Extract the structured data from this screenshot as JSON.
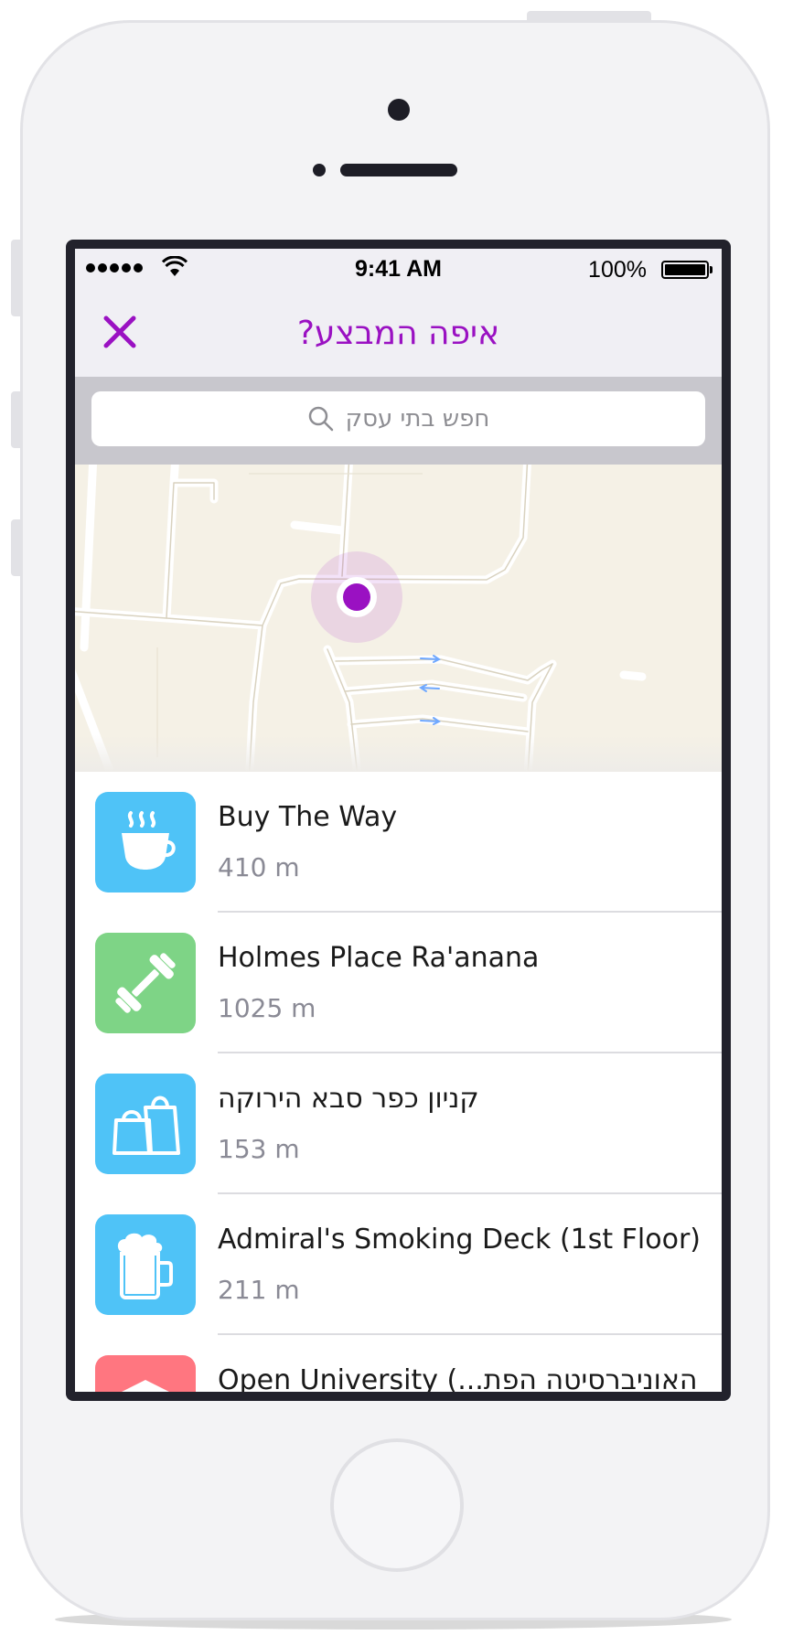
{
  "status_bar": {
    "time": "9:41 AM",
    "battery": "100%"
  },
  "nav": {
    "title": "איפה המבצע?",
    "close_icon": "close-icon",
    "accent_color": "#9a11c2"
  },
  "search": {
    "placeholder": "חפש בתי עסק",
    "icon": "search-icon"
  },
  "map": {
    "location_color": "#9a11c2"
  },
  "places": [
    {
      "name": "Buy The Way",
      "distance": "410 m",
      "icon": "coffee-cup-icon",
      "color": "#4fc3f7"
    },
    {
      "name": "Holmes Place Ra'anana",
      "distance": "1025 m",
      "icon": "dumbbell-icon",
      "color": "#7ed486"
    },
    {
      "name": "קניון כפר סבא הירוקה",
      "distance": "153 m",
      "icon": "shopping-bags-icon",
      "color": "#4fc3f7"
    },
    {
      "name": "Admiral's Smoking Deck (1st Floor)",
      "distance": "211 m",
      "icon": "beer-mug-icon",
      "color": "#4fc3f7"
    },
    {
      "name": "Open University (...האוניברסיטה הפת",
      "distance": "",
      "icon": "university-icon",
      "color": "#ff7680"
    }
  ]
}
